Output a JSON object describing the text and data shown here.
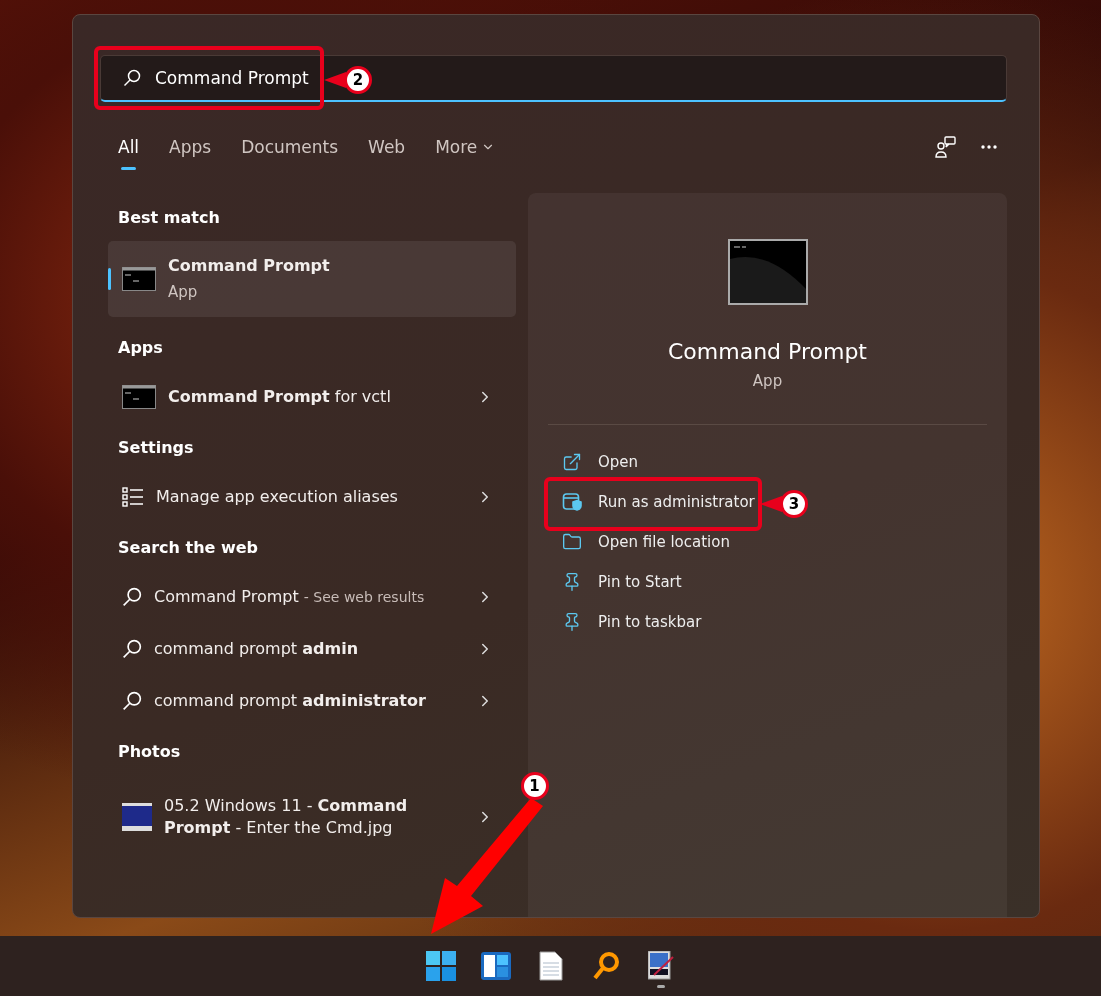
{
  "search": {
    "value": "Command Prompt",
    "callout": "2"
  },
  "tabs": [
    {
      "label": "All",
      "selected": true,
      "kind": "tab"
    },
    {
      "label": "Apps",
      "selected": false,
      "kind": "tab"
    },
    {
      "label": "Documents",
      "selected": false,
      "kind": "tab"
    },
    {
      "label": "Web",
      "selected": false,
      "kind": "tab"
    },
    {
      "label": "More",
      "selected": false,
      "kind": "dropdown"
    }
  ],
  "sections": [
    {
      "heading": "Best match",
      "items": [
        {
          "kind": "best",
          "text": "Command Prompt",
          "subtitle": "App",
          "selected": true
        }
      ]
    },
    {
      "heading": "Apps",
      "items": [
        {
          "kind": "app",
          "text": "**Command Prompt** for vctl",
          "selected": false
        }
      ]
    },
    {
      "heading": "Settings",
      "items": [
        {
          "kind": "setting",
          "text": "Manage app execution aliases",
          "selected": false
        }
      ]
    },
    {
      "heading": "Search the web",
      "items": [
        {
          "kind": "web",
          "text": "Command Prompt",
          "note": "- See web results",
          "selected": false
        },
        {
          "kind": "web",
          "text": "command prompt **admin**",
          "selected": false
        },
        {
          "kind": "web",
          "text": "command prompt **administrator**",
          "selected": false
        }
      ]
    },
    {
      "heading": "Photos",
      "items": [
        {
          "kind": "photo",
          "text": "05.2 Windows 11 - **Command Prompt** - Enter the Cmd.jpg",
          "selected": false
        }
      ]
    }
  ],
  "preview": {
    "title": "Command Prompt",
    "subtitle": "App",
    "actions": [
      {
        "label": "Open",
        "kind": "open"
      },
      {
        "label": "Run as administrator",
        "kind": "admin",
        "callout": "3"
      },
      {
        "label": "Open file location",
        "kind": "folder"
      },
      {
        "label": "Pin to Start",
        "kind": "pin"
      },
      {
        "label": "Pin to taskbar",
        "kind": "pin"
      }
    ]
  },
  "taskbar": [
    {
      "kind": "start",
      "running": false,
      "callout": "1"
    },
    {
      "kind": "widgets",
      "running": false
    },
    {
      "kind": "document",
      "running": false
    },
    {
      "kind": "magnifier",
      "running": false
    },
    {
      "kind": "editor",
      "running": true
    }
  ]
}
